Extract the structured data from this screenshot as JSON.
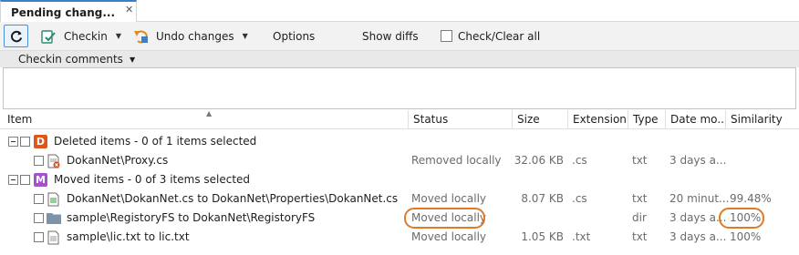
{
  "tab": {
    "title": "Pending chang...",
    "close_glyph": "✕"
  },
  "toolbar": {
    "checkin_label": "Checkin",
    "undo_label": "Undo changes",
    "options_label": "Options",
    "show_diffs_label": "Show diffs",
    "check_clear_label": "Check/Clear all",
    "dropdown_glyph": "▼"
  },
  "comments": {
    "label": "Checkin comments",
    "dropdown_glyph": "▼",
    "value": ""
  },
  "table": {
    "sort_glyph": "▲",
    "columns": [
      "Item",
      "Status",
      "Size",
      "Extension",
      "Type",
      "Date mo...",
      "Similarity"
    ],
    "groups": [
      {
        "badge": "D",
        "badge_color": "#e0561a",
        "label": "Deleted items - 0 of 1 items selected",
        "rows": [
          {
            "icon": "deleted-file-icon",
            "name": "DokanNet\\Proxy.cs",
            "status": "Removed locally",
            "size": "32.06 KB",
            "extension": ".cs",
            "type": "txt",
            "date": "3 days a...",
            "similarity": ""
          }
        ]
      },
      {
        "badge": "M",
        "badge_color": "#a64fcf",
        "label": "Moved items - 0 of 3 items selected",
        "rows": [
          {
            "icon": "file-icon",
            "name": "DokanNet\\DokanNet.cs to DokanNet\\Properties\\DokanNet.cs",
            "status": "Moved locally",
            "size": "8.07 KB",
            "extension": ".cs",
            "type": "txt",
            "date": "20 minut...",
            "similarity": "99.48%"
          },
          {
            "icon": "folder-icon",
            "name": "sample\\RegistoryFS to DokanNet\\RegistoryFS",
            "status": "Moved locally",
            "size": "",
            "extension": "",
            "type": "dir",
            "date": "3 days a...",
            "similarity": "100%"
          },
          {
            "icon": "text-file-icon",
            "name": "sample\\lic.txt to lic.txt",
            "status": "Moved locally",
            "size": "1.05 KB",
            "extension": ".txt",
            "type": "txt",
            "date": "3 days a...",
            "similarity": "100%"
          }
        ]
      }
    ]
  },
  "colors": {
    "accent": "#3c7fc9",
    "highlight_circle": "#e07b22",
    "checkin_icon": "#2a8a6e",
    "undo_icon": "#e08a1e"
  }
}
